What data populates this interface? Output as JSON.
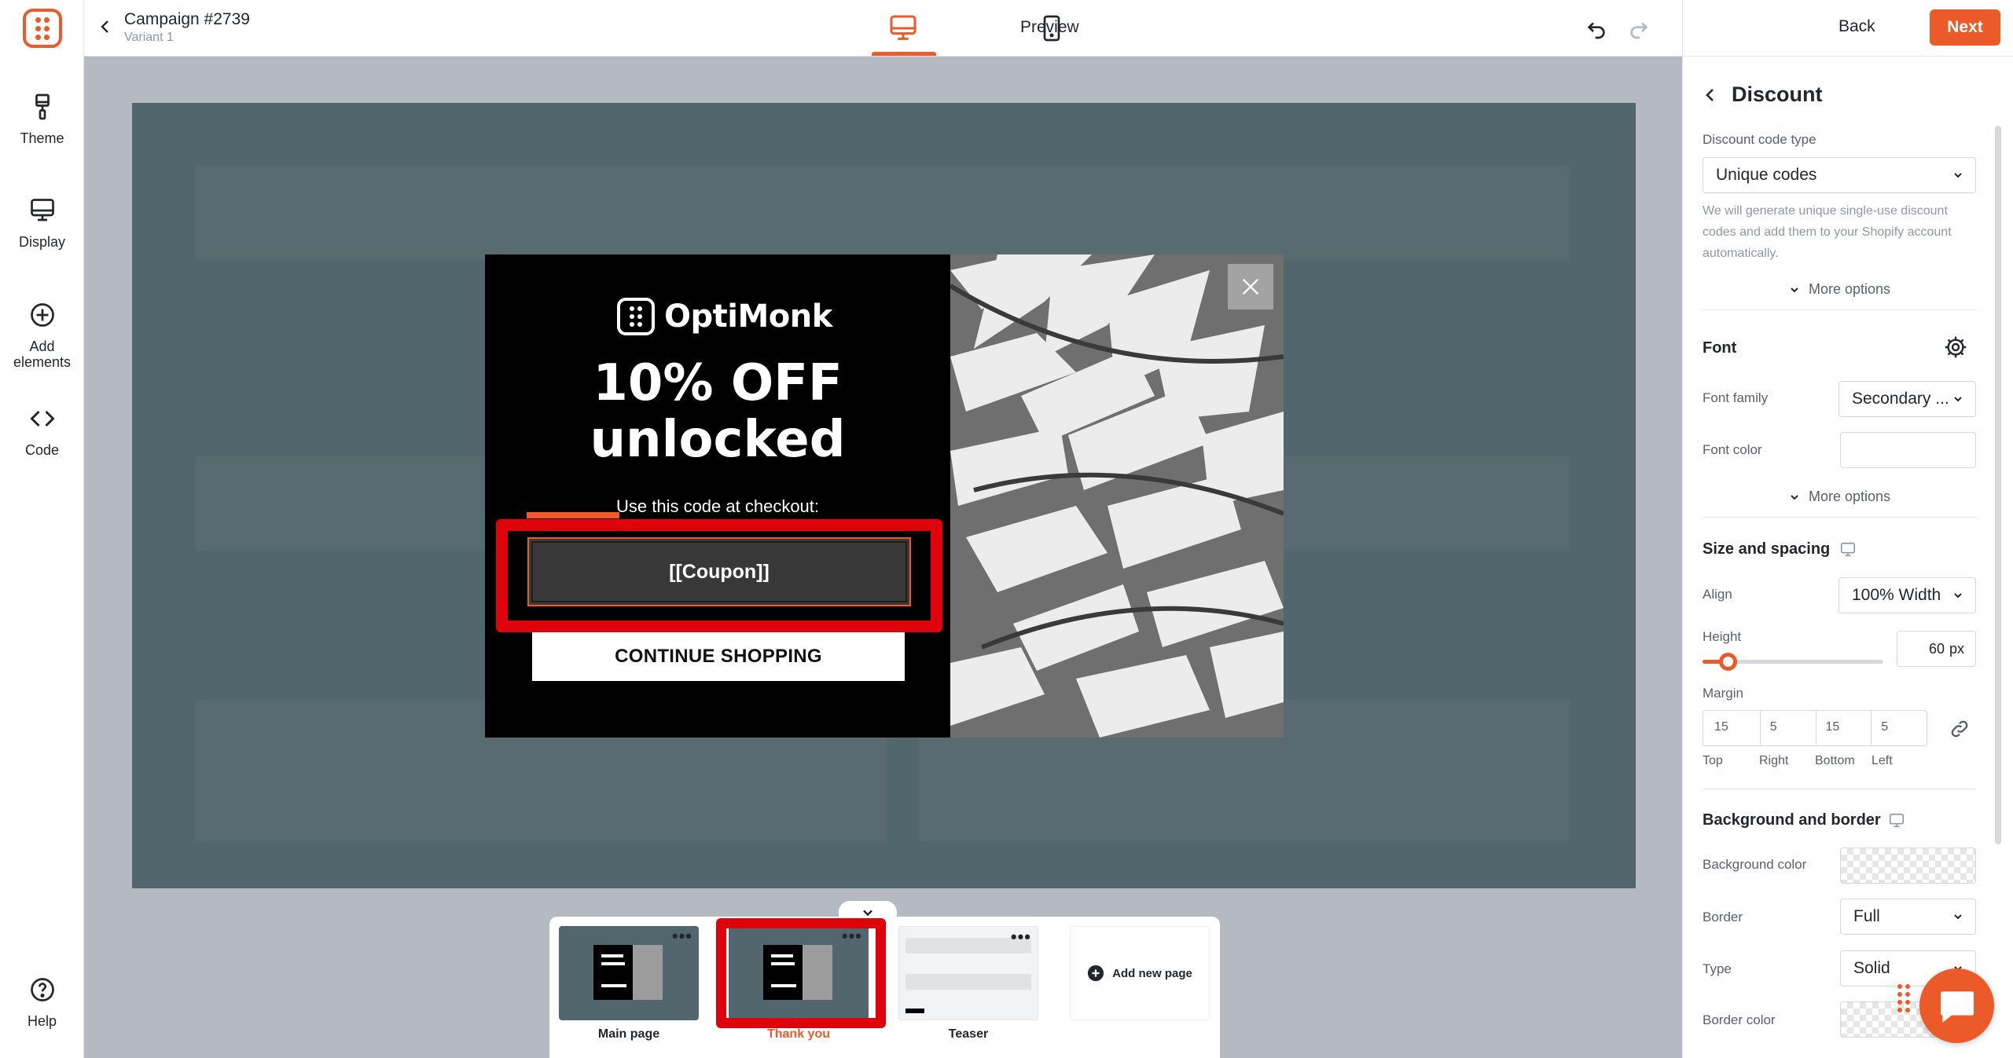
{
  "header": {
    "campaign_title": "Campaign #2739",
    "variant": "Variant 1",
    "preview": "Preview",
    "back": "Back",
    "next": "Next"
  },
  "rail": {
    "theme": "Theme",
    "display": "Display",
    "add_elements": "Add elements",
    "code": "Code",
    "help": "Help"
  },
  "popup": {
    "brand": "OptiMonk",
    "headline_1": "10% OFF",
    "headline_2": "unlocked",
    "use_code": "Use this code at checkout:",
    "coupon": "[[Coupon]]",
    "continue": "CONTINUE SHOPPING"
  },
  "pages": {
    "items": [
      {
        "label": "Main page"
      },
      {
        "label": "Thank you"
      },
      {
        "label": "Teaser"
      }
    ],
    "add_new": "Add new page"
  },
  "panel": {
    "title": "Discount",
    "code_type_label": "Discount code type",
    "code_type_value": "Unique codes",
    "code_type_help": "We will generate unique single-use discount codes and add them to your Shopify account automatically.",
    "more_options": "More options",
    "font_head": "Font",
    "font_family_label": "Font family",
    "font_family_value": "Secondary ...",
    "font_color_label": "Font color",
    "size_head": "Size and spacing",
    "align_label": "Align",
    "align_value": "100% Width",
    "height_label": "Height",
    "height_value": "60",
    "height_unit": "px",
    "height_slider_fraction": 0.14,
    "margin_label": "Margin",
    "margin": {
      "top": "15",
      "right": "5",
      "bottom": "15",
      "left": "5"
    },
    "margin_labels": {
      "top": "Top",
      "right": "Right",
      "bottom": "Bottom",
      "left": "Left"
    },
    "bg_head": "Background and border",
    "bg_color_label": "Background color",
    "border_label": "Border",
    "border_value": "Full",
    "type_label": "Type",
    "type_value": "Solid",
    "border_color_label": "Border color"
  },
  "colors": {
    "accent": "#ed5a29",
    "highlight_red": "#e0020b",
    "canvas_bg": "#52676d"
  }
}
